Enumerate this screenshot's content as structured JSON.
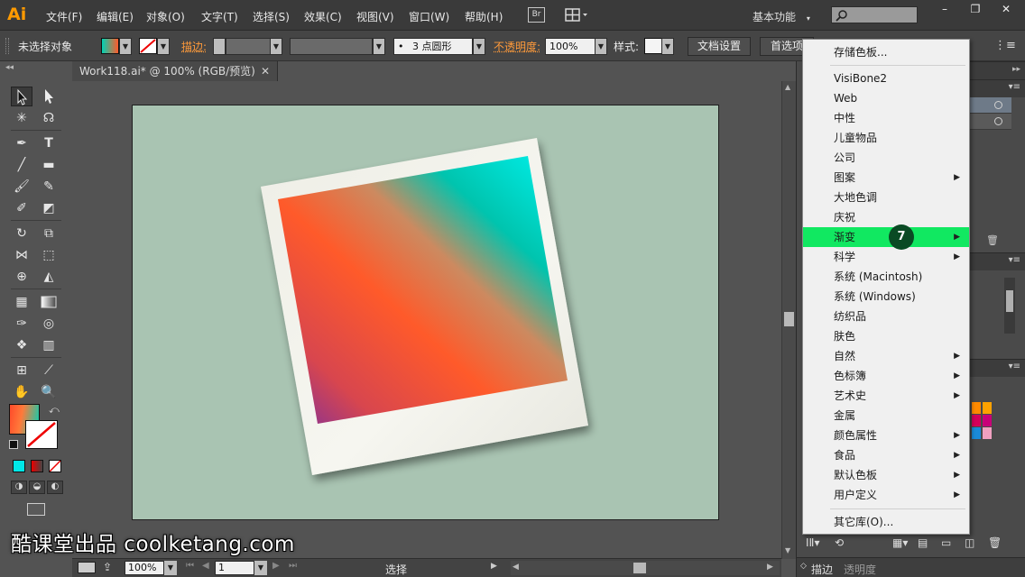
{
  "app": {
    "logo": "Ai"
  },
  "menubar": {
    "items": [
      "文件(F)",
      "编辑(E)",
      "对象(O)",
      "文字(T)",
      "选择(S)",
      "效果(C)",
      "视图(V)",
      "窗口(W)",
      "帮助(H)"
    ],
    "bridge_label": "Br",
    "workspace_label": "基本功能",
    "window_buttons": [
      "–",
      "❐",
      "✕"
    ]
  },
  "controlbar": {
    "selection_label": "未选择对象",
    "stroke_label": "描边:",
    "brush_label": "3 点圆形",
    "opacity_label": "不透明度:",
    "opacity_value": "100%",
    "style_label": "样式:",
    "doc_setup_label": "文档设置",
    "preferences_label": "首选项"
  },
  "document": {
    "tab_title": "Work118.ai* @ 100% (RGB/预览)",
    "tab_close": "✕"
  },
  "statusbar": {
    "zoom_value": "100%",
    "page_value": "1",
    "status_text": "选择"
  },
  "panel_tabs": [
    "描边",
    "透明度"
  ],
  "dropdown": {
    "items": [
      {
        "label": "存储色板...",
        "submenu": false
      },
      {
        "label": "VisiBone2",
        "submenu": false
      },
      {
        "label": "Web",
        "submenu": false
      },
      {
        "label": "中性",
        "submenu": false
      },
      {
        "label": "儿童物品",
        "submenu": false
      },
      {
        "label": "公司",
        "submenu": false
      },
      {
        "label": "图案",
        "submenu": true
      },
      {
        "label": "大地色调",
        "submenu": false
      },
      {
        "label": "庆祝",
        "submenu": false
      },
      {
        "label": "渐变",
        "submenu": true,
        "highlighted": true
      },
      {
        "label": "科学",
        "submenu": true
      },
      {
        "label": "系统 (Macintosh)",
        "submenu": false
      },
      {
        "label": "系统 (Windows)",
        "submenu": false
      },
      {
        "label": "纺织品",
        "submenu": false
      },
      {
        "label": "肤色",
        "submenu": false
      },
      {
        "label": "自然",
        "submenu": true
      },
      {
        "label": "色标簿",
        "submenu": true
      },
      {
        "label": "艺术史",
        "submenu": true
      },
      {
        "label": "金属",
        "submenu": false
      },
      {
        "label": "颜色属性",
        "submenu": true
      },
      {
        "label": "食品",
        "submenu": true
      },
      {
        "label": "默认色板",
        "submenu": true
      },
      {
        "label": "用户定义",
        "submenu": true
      },
      {
        "label": "其它库(O)...",
        "submenu": false
      }
    ],
    "step_badge": "7"
  },
  "watermark": "酷课堂出品 coolketang.com",
  "colors": {
    "accent_highlight": "#11e861",
    "artboard_bg": "#a9c4b2",
    "gradient_orange": "#ff5a2a",
    "gradient_teal": "#00d2b4",
    "gradient_purple": "#7a2ea0"
  }
}
